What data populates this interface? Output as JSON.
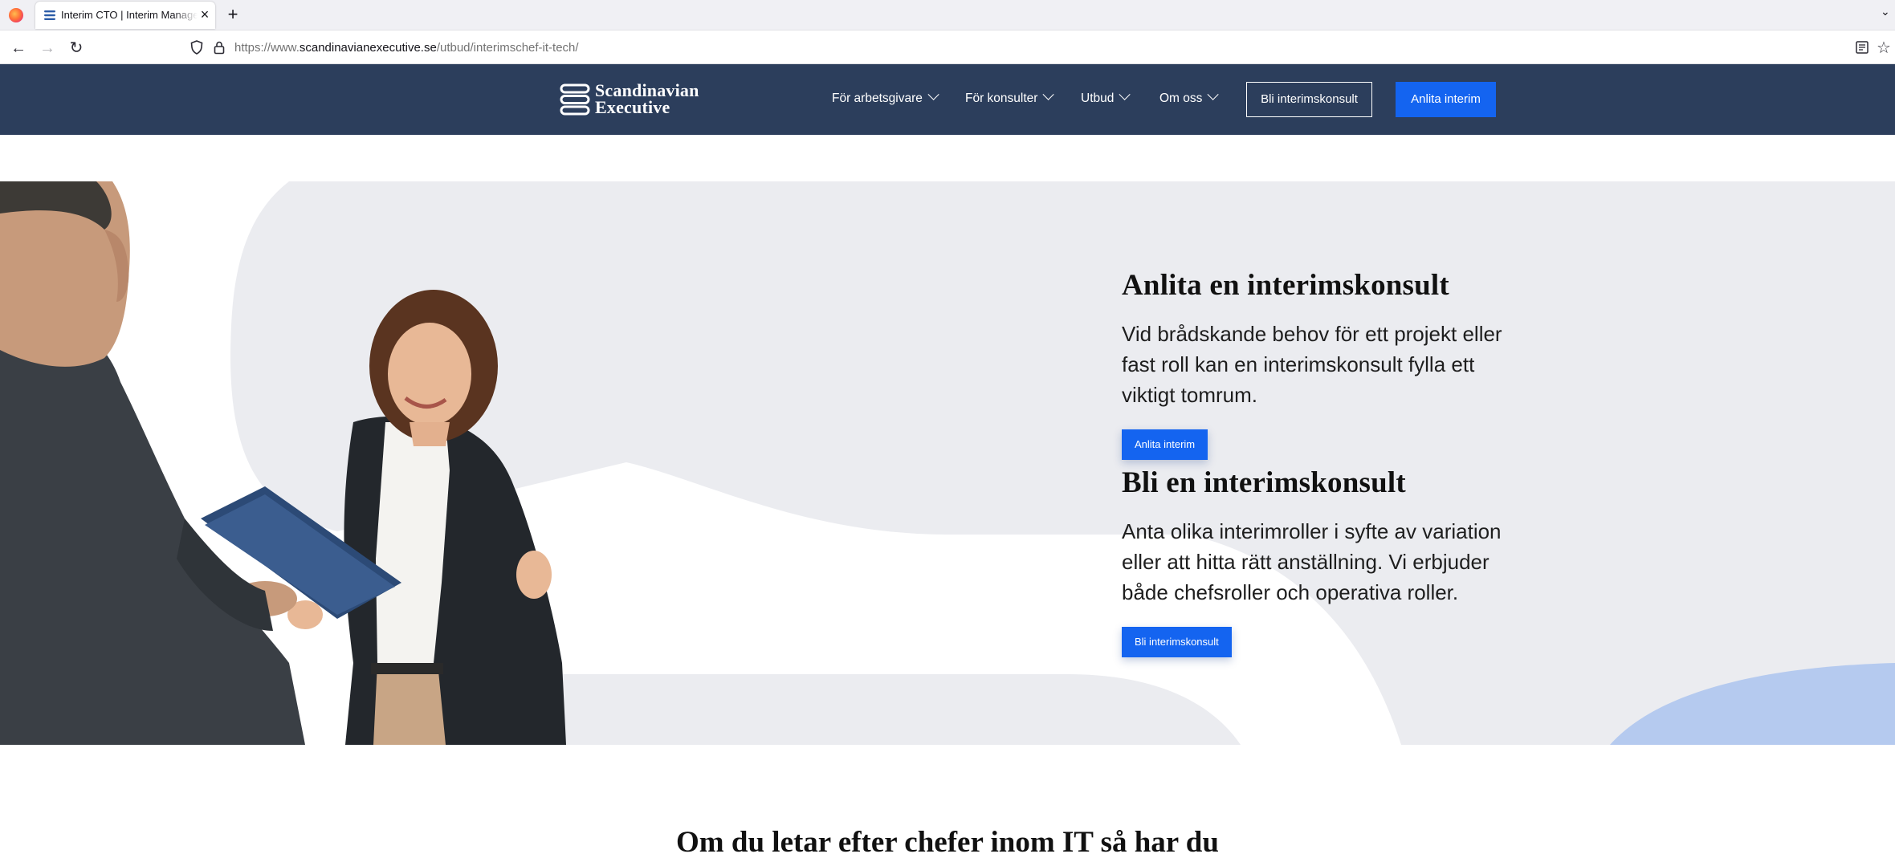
{
  "browser": {
    "tab_title": "Interim CTO | Interim Management",
    "url_prefix": "https://www.",
    "url_host": "scandinavianexecutive.se",
    "url_path": "/utbud/interimschef-it-tech/"
  },
  "header": {
    "logo_line1": "Scandinavian",
    "logo_line2": "Executive",
    "menu": [
      {
        "label": "För arbetsgivare"
      },
      {
        "label": "För konsulter"
      },
      {
        "label": "Utbud"
      },
      {
        "label": "Om oss"
      }
    ],
    "outline_button": "Bli interimskonsult",
    "primary_button": "Anlita interim"
  },
  "hero": {
    "block1": {
      "title": "Anlita en interimskonsult",
      "text": "Vid brådskande behov för ett projekt eller fast roll kan en interimskonsult fylla ett viktigt tomrum.",
      "button": "Anlita interim"
    },
    "block2": {
      "title": "Bli en interimskonsult",
      "text": "Anta olika interimroller i syfte av variation eller att hitta rätt anställning. Vi erbjuder både chefsroller och operativa roller.",
      "button": "Bli interimskonsult"
    }
  },
  "section": {
    "title": "Om du letar efter chefer inom IT så har du"
  },
  "colors": {
    "header_bg": "#2c3e5c",
    "accent_blue": "#1464f0",
    "hero_gray": "#ebecf0",
    "hero_blue_shape": "#b5caef"
  }
}
